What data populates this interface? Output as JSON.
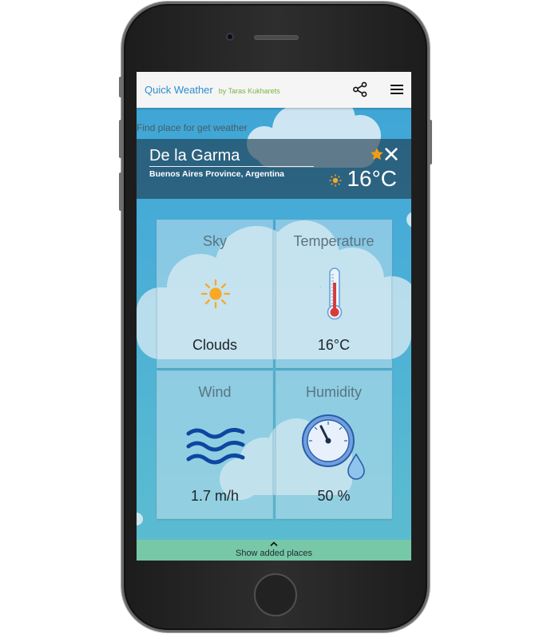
{
  "header": {
    "title": "Quick Weather",
    "author": "by Taras Kukharets",
    "share_icon": "share-icon",
    "menu_icon": "hamburger-menu-icon"
  },
  "search": {
    "label": "Find place for get weather"
  },
  "place": {
    "name": "De la Garma",
    "region": "Buenos Aires Province, Argentina",
    "temperature": "16°C",
    "favorite_icon": "star-icon",
    "close_icon": "close-icon",
    "condition_icon": "sun-icon"
  },
  "cards": [
    {
      "title": "Sky",
      "value": "Clouds",
      "icon": "sun-icon"
    },
    {
      "title": "Temperature",
      "value": "16°C",
      "icon": "thermometer-icon"
    },
    {
      "title": "Wind",
      "value": "1.7 m/h",
      "icon": "wind-waves-icon"
    },
    {
      "title": "Humidity",
      "value": "50 %",
      "icon": "hygrometer-icon"
    }
  ],
  "footer": {
    "label": "Show added places",
    "icon": "chevron-up-icon"
  },
  "colors": {
    "title_blue": "#2a8fcf",
    "author_green": "#7cb342",
    "sky_blue": "#3ca4d6",
    "sun_orange": "#f9a825",
    "star_orange": "#f39c12",
    "footer_green": "#77c8a6"
  }
}
